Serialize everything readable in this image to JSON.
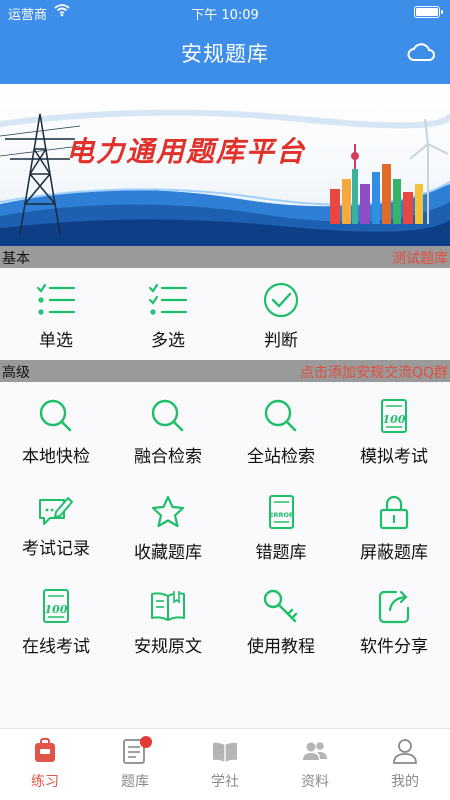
{
  "status_bar": {
    "carrier": "运营商",
    "time": "下午 10:09"
  },
  "header": {
    "title": "安规题库",
    "cloud_icon": "cloud-icon"
  },
  "banner": {
    "title": "电力通用题库平台"
  },
  "basic": {
    "title": "基本",
    "link": "测试题库",
    "items": [
      {
        "label": "单选",
        "icon": "list-icon"
      },
      {
        "label": "多选",
        "icon": "list-icon"
      },
      {
        "label": "判断",
        "icon": "check-circle-icon"
      }
    ]
  },
  "advanced": {
    "title": "高级",
    "link": "点击添加安规交流QQ群",
    "items": [
      {
        "label": "本地快检",
        "icon": "search-icon"
      },
      {
        "label": "融合检索",
        "icon": "search-icon"
      },
      {
        "label": "全站检索",
        "icon": "search-icon"
      },
      {
        "label": "模拟考试",
        "icon": "exam-score-icon"
      },
      {
        "label": "考试记录",
        "icon": "chat-edit-icon"
      },
      {
        "label": "收藏题库",
        "icon": "star-icon"
      },
      {
        "label": "错题库",
        "icon": "error-book-icon"
      },
      {
        "label": "屏蔽题库",
        "icon": "lock-icon"
      },
      {
        "label": "在线考试",
        "icon": "exam-score-icon"
      },
      {
        "label": "安规原文",
        "icon": "book-icon"
      },
      {
        "label": "使用教程",
        "icon": "key-icon"
      },
      {
        "label": "软件分享",
        "icon": "share-icon"
      }
    ]
  },
  "tabbar": {
    "items": [
      {
        "label": "练习",
        "icon": "practice-bag-icon",
        "active": true
      },
      {
        "label": "题库",
        "icon": "question-bank-icon",
        "badge": true
      },
      {
        "label": "学社",
        "icon": "open-book-icon"
      },
      {
        "label": "资料",
        "icon": "people-icon"
      },
      {
        "label": "我的",
        "icon": "user-icon"
      }
    ]
  },
  "colors": {
    "header": "#3d8ee8",
    "accent_green": "#1fbf6a",
    "link_red": "#e34d3d",
    "tab_active": "#e0544a",
    "tab_inactive": "#8a8a8a"
  }
}
